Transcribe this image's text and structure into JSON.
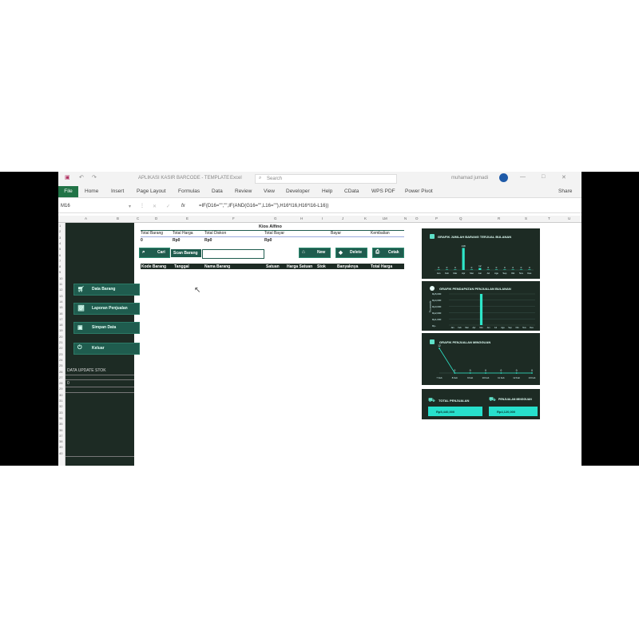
{
  "window": {
    "filename": "APLIKASI KASIR BARCODE - TEMPLATE",
    "app": "Excel",
    "search_placeholder": "Search",
    "user": "muhamad jumadi"
  },
  "ribbon": {
    "tabs": [
      "File",
      "Home",
      "Insert",
      "Page Layout",
      "Formulas",
      "Data",
      "Review",
      "View",
      "Developer",
      "Help",
      "CData",
      "WPS PDF",
      "Power Pivot"
    ],
    "share": "Share"
  },
  "formula_bar": {
    "name_box": "M16",
    "fx": "fx",
    "formula": "=IF(D16=\"\",\"\",IF(AND(G16=\"\",L16=\"\"),H16*I16,H16*I16-L16))"
  },
  "column_headers": [
    "A",
    "B",
    "C",
    "D",
    "E",
    "F",
    "G",
    "H",
    "I",
    "J",
    "K",
    "L",
    "M",
    "N",
    "O",
    "P",
    "Q",
    "R",
    "S",
    "T",
    "U"
  ],
  "sidebar": {
    "buttons": [
      {
        "label": "Data Barang",
        "icon": "cart-icon"
      },
      {
        "label": "Laporan Penjualan",
        "icon": "chart-icon"
      },
      {
        "label": "Simpan Data",
        "icon": "save-icon"
      },
      {
        "label": "Keluar",
        "icon": "power-icon"
      }
    ],
    "stock_label": "DATA UPDATE STOK",
    "stock_value": "0"
  },
  "kasir": {
    "title": "Kios Alfino",
    "summary": [
      {
        "label": "Total Barang",
        "value": "0"
      },
      {
        "label": "Total Harga",
        "value": "Rp0"
      },
      {
        "label": "Total Diskon",
        "value": "Rp0"
      },
      {
        "label": "Total Bayar",
        "value": "Rp0"
      },
      {
        "label": "Bayar",
        "value": ""
      },
      {
        "label": "Kembalian",
        "value": ""
      }
    ],
    "cari_button": "Cari",
    "scan_label": "Scan Barang",
    "new_button": "New",
    "delete_button": "Delete",
    "cetak_button": "Cetak",
    "table_headers": [
      "Kode Barang",
      "Tanggal",
      "Nama Barang",
      "Satuan",
      "Harga Satuan",
      "Stok",
      "Banyaknya",
      "Total Harga"
    ]
  },
  "dashboard": {
    "chart1": {
      "title": "GRAFIK JUMLAH BARANG TERJUAL BULANAN",
      "accent": "#2ee6c9"
    },
    "chart2": {
      "title": "GRAFIK PENDAPATAN PENJUALAN BULANAN",
      "ylabel": "Thousands",
      "ticks": [
        "Rp5,000",
        "Rp4,000",
        "Rp3,000",
        "Rp2,000",
        "Rp1,000",
        "Rp-"
      ]
    },
    "chart3": {
      "title": "GRAFIK PENJUALAN MINGGUAN"
    },
    "total_penjualan": {
      "label": "TOTAL PENJUALAN",
      "value": "Rp5,440,000"
    },
    "penjualan_mingguan": {
      "label": "PENJUALAN MINGGUAN",
      "value": "Rp4,120,000"
    }
  },
  "chart_data": [
    {
      "type": "bar",
      "title": "GRAFIK JUMLAH BARANG TERJUAL BULANAN",
      "categories": [
        "Jan",
        "Feb",
        "Mar",
        "Apr",
        "Mei",
        "Jun",
        "Jul",
        "Agu",
        "Sep",
        "Okt",
        "Nov",
        "Des"
      ],
      "values": [
        0,
        0,
        0,
        138,
        0,
        12,
        0,
        0,
        0,
        0,
        0,
        0
      ],
      "ylim": [
        0,
        150
      ]
    },
    {
      "type": "bar",
      "title": "GRAFIK PENDAPATAN PENJUALAN BULANAN",
      "categories": [
        "Jan",
        "Feb",
        "Mar",
        "Apr",
        "Mei",
        "Jun",
        "Jul",
        "Agu",
        "Sep",
        "Okt",
        "Nov",
        "Des"
      ],
      "values": [
        0,
        0,
        0,
        0,
        5440,
        0,
        0,
        0,
        0,
        0,
        0,
        0
      ],
      "ylim": [
        0,
        5000
      ]
    },
    {
      "type": "line",
      "title": "GRAFIK PENJUALAN MINGGUAN",
      "categories": [
        "7 Feb",
        "8 Feb",
        "9 Feb",
        "10 Feb",
        "11 Feb",
        "12 Feb",
        "13 Feb"
      ],
      "values": [
        12,
        0,
        0,
        0,
        0,
        0,
        0
      ],
      "ylim": [
        0,
        14
      ]
    }
  ]
}
